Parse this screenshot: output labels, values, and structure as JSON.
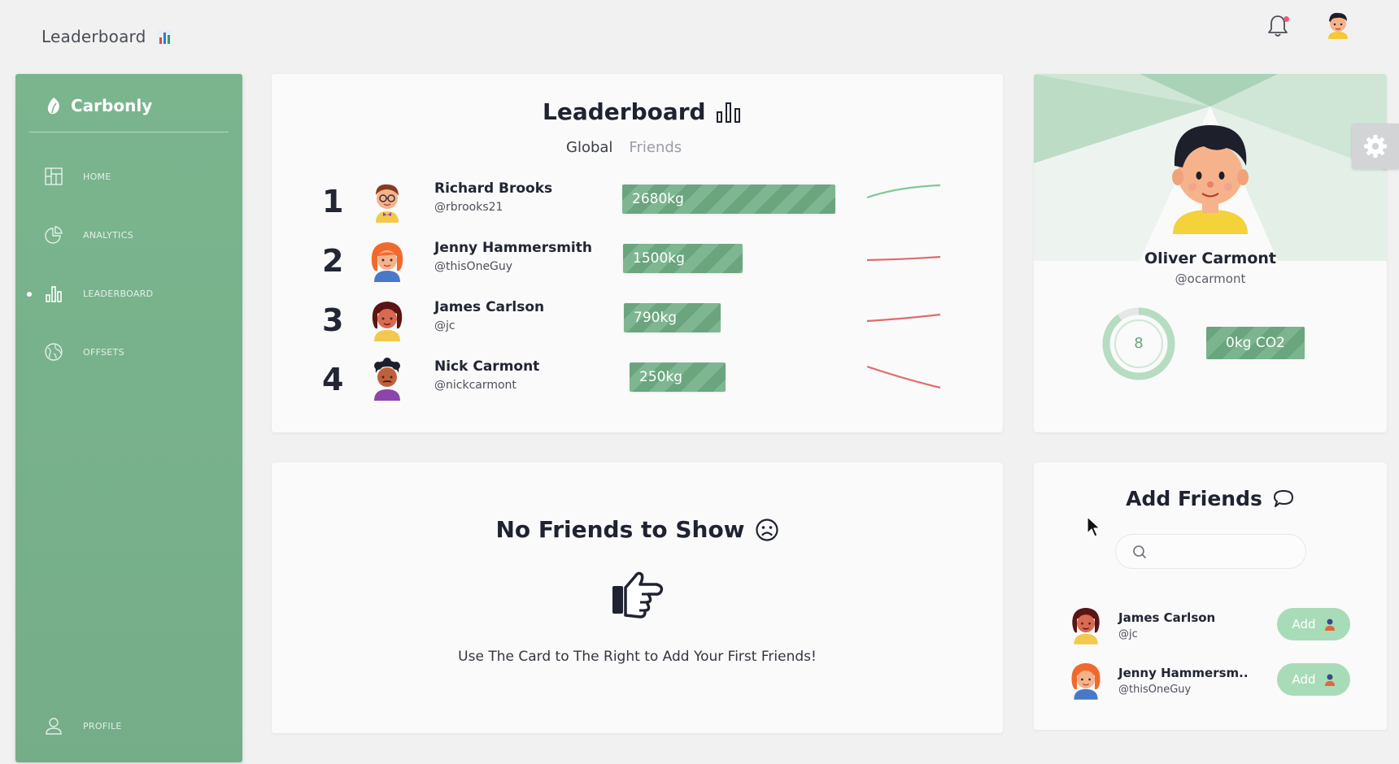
{
  "topbar": {
    "title": "Leaderboard",
    "title_emoji": "bar-chart-emoji",
    "notification_icon": "bell-icon",
    "has_notification": true,
    "avatar_icon": "user-avatar"
  },
  "sidebar": {
    "brand": "Carbonly",
    "brand_icon": "leaf-icon",
    "items": [
      {
        "label": "HOME",
        "icon": "home-dashboard-icon",
        "active": false
      },
      {
        "label": "ANALYTICS",
        "icon": "pie-chart-icon",
        "active": false
      },
      {
        "label": "LEADERBOARD",
        "icon": "bar-chart-icon",
        "active": true
      },
      {
        "label": "OFFSETS",
        "icon": "globe-icon",
        "active": false
      },
      {
        "label": "PROFILE",
        "icon": "user-icon",
        "active": false
      }
    ]
  },
  "leaderboard": {
    "title": "Leaderboard",
    "tabs": [
      {
        "label": "Global",
        "active": true
      },
      {
        "label": "Friends",
        "active": false
      }
    ],
    "rows": [
      {
        "rank": "1",
        "name": "Richard Brooks",
        "handle": "@rbrooks21",
        "value": "2680kg",
        "trend": "up"
      },
      {
        "rank": "2",
        "name": "Jenny Hammersmith",
        "handle": "@thisOneGuy",
        "value": "1500kg",
        "trend": "flat"
      },
      {
        "rank": "3",
        "name": "James Carlson",
        "handle": "@jc",
        "value": "790kg",
        "trend": "flat"
      },
      {
        "rank": "4",
        "name": "Nick Carmont",
        "handle": "@nickcarmont",
        "value": "250kg",
        "trend": "down"
      }
    ]
  },
  "profile": {
    "name": "Oliver Carmont",
    "handle": "@ocarmont",
    "ring_value": "8",
    "co2": "0kg CO2"
  },
  "no_friends": {
    "title": "No Friends to Show",
    "message": "Use The Card to The Right to Add Your First Friends!"
  },
  "add_friends": {
    "title": "Add Friends",
    "search_placeholder": "",
    "suggestions": [
      {
        "name": "James Carlson",
        "handle": "@jc",
        "button": "Add"
      },
      {
        "name": "Jenny Hammersm..",
        "handle": "@thisOneGuy",
        "button": "Add"
      }
    ]
  },
  "colors": {
    "accent_green": "#6aa57e",
    "sidebar_green": "#78b28c",
    "trend_up": "#7fc89a",
    "trend_down": "#e06a6a",
    "add_button": "#a8dcb8"
  }
}
